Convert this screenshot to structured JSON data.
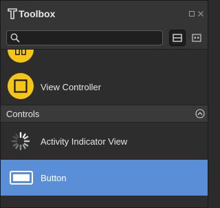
{
  "window": {
    "title": "Toolbox"
  },
  "search": {
    "value": "",
    "placeholder": ""
  },
  "items": [
    {
      "label": "View Controller",
      "icon": "view-controller-icon"
    }
  ],
  "sections": [
    {
      "label": "Controls",
      "expanded": true
    }
  ],
  "controls": [
    {
      "label": "Activity Indicator View",
      "icon": "activity-indicator-icon",
      "selected": false
    },
    {
      "label": "Button",
      "icon": "button-icon",
      "selected": true
    }
  ],
  "colors": {
    "accent": "#5a8fd8",
    "icon_yellow": "#f5c518",
    "background": "#2d2d2d"
  }
}
